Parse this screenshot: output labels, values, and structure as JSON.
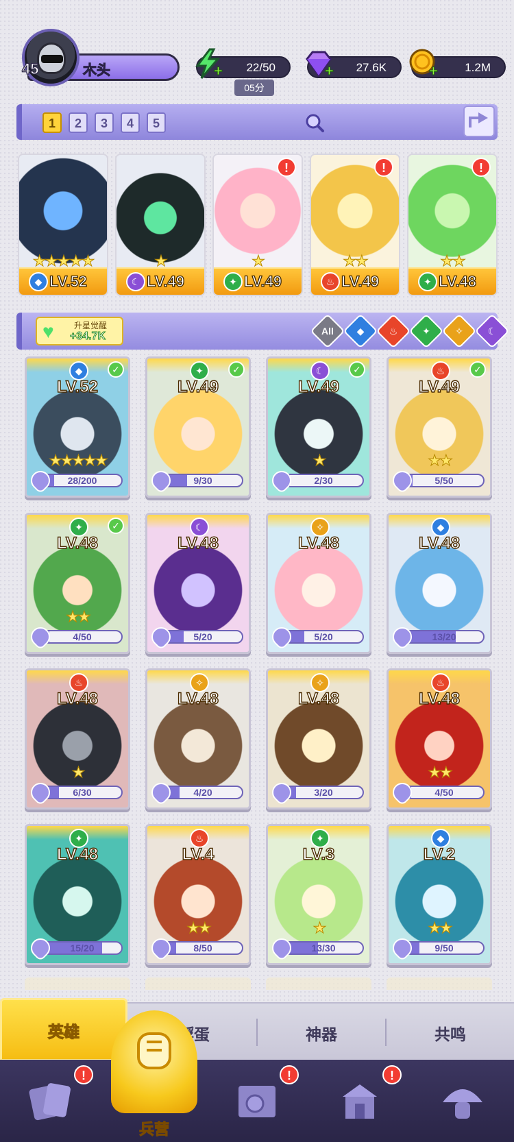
{
  "player": {
    "level": "45",
    "name": "木头"
  },
  "resources": {
    "energy": {
      "value": "22/50",
      "timer": "05分"
    },
    "gems": {
      "value": "27.6K"
    },
    "gold": {
      "value": "1.2M"
    }
  },
  "team": {
    "tabs": [
      "1",
      "2",
      "3",
      "4",
      "5"
    ],
    "active_tab": "1",
    "members": [
      {
        "level": "LV.52",
        "element": "water",
        "stars": "★★★★★",
        "alert": false
      },
      {
        "level": "LV.49",
        "element": "dark",
        "stars": "★",
        "alert": false
      },
      {
        "level": "LV.49",
        "element": "wind",
        "stars": "★",
        "alert": true
      },
      {
        "level": "LV.49",
        "element": "fire",
        "stars": "★★",
        "alert": true
      },
      {
        "level": "LV.48",
        "element": "wind",
        "stars": "★★",
        "alert": true
      }
    ]
  },
  "filter": {
    "awaken_label": "升星觉醒",
    "awaken_value": "+34.7K",
    "all_label": "All",
    "elements": [
      "water",
      "fire",
      "wind",
      "light",
      "dark"
    ]
  },
  "heroes": [
    {
      "level": "LV.52",
      "element": "water",
      "stars": "★★★★★",
      "progress": "28/200",
      "check": true
    },
    {
      "level": "LV.49",
      "element": "wind",
      "stars": "",
      "progress": "9/30",
      "check": true
    },
    {
      "level": "LV.49",
      "element": "dark",
      "stars": "★",
      "progress": "2/30",
      "check": true
    },
    {
      "level": "LV.49",
      "element": "fire",
      "stars": "★★",
      "progress": "5/50",
      "check": true
    },
    {
      "level": "LV.48",
      "element": "wind",
      "stars": "★★",
      "progress": "4/50",
      "check": true
    },
    {
      "level": "LV.48",
      "element": "dark",
      "stars": "",
      "progress": "5/20",
      "check": false
    },
    {
      "level": "LV.48",
      "element": "light",
      "stars": "",
      "progress": "5/20",
      "check": false
    },
    {
      "level": "LV.48",
      "element": "water",
      "stars": "",
      "progress": "13/20",
      "check": false
    },
    {
      "level": "LV.48",
      "element": "fire",
      "stars": "★",
      "progress": "6/30",
      "check": false
    },
    {
      "level": "LV.48",
      "element": "light",
      "stars": "",
      "progress": "4/20",
      "check": false
    },
    {
      "level": "LV.48",
      "element": "light",
      "stars": "",
      "progress": "3/20",
      "check": false
    },
    {
      "level": "LV.48",
      "element": "fire",
      "stars": "★★",
      "progress": "4/50",
      "check": false
    },
    {
      "level": "LV.48",
      "element": "wind",
      "stars": "",
      "progress": "15/20",
      "check": false
    },
    {
      "level": "LV.4",
      "element": "fire",
      "stars": "★★",
      "progress": "8/50",
      "check": false
    },
    {
      "level": "LV.3",
      "element": "wind",
      "stars": "★",
      "progress": "13/30",
      "check": false
    },
    {
      "level": "LV.2",
      "element": "water",
      "stars": "★★",
      "progress": "9/50",
      "check": false
    }
  ],
  "subtabs": [
    "英雄",
    "孵蛋",
    "神器",
    "共鸣"
  ],
  "nav": {
    "items": [
      {
        "label": "",
        "alert": true
      },
      {
        "label": "兵营",
        "alert": false
      },
      {
        "label": "",
        "alert": true
      },
      {
        "label": "",
        "alert": true
      },
      {
        "label": "",
        "alert": false
      }
    ]
  },
  "colors": {
    "water": "#2f7fe0",
    "fire": "#e8452a",
    "wind": "#2fae4a",
    "light": "#e9a21a",
    "dark": "#8a4fd6",
    "accent": "#ffd33a"
  }
}
